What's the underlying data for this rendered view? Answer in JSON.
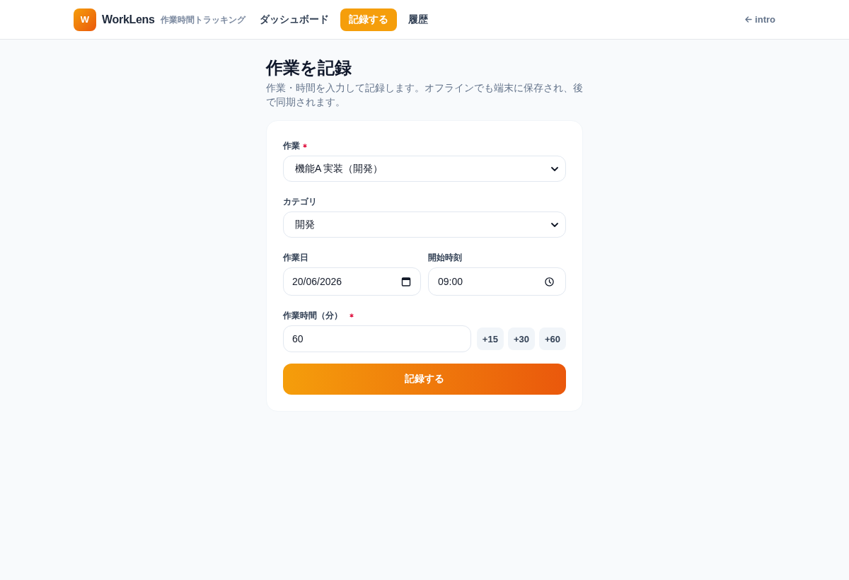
{
  "header": {
    "logo": {
      "letter": "W",
      "name": "WorkLens",
      "tagline": "作業時間トラッキング"
    },
    "nav": [
      {
        "label": "ダッシュボード",
        "selected": false
      },
      {
        "label": "記録する",
        "selected": true
      },
      {
        "label": "履歴",
        "selected": false
      }
    ],
    "back_link": {
      "label": "intro"
    }
  },
  "page": {
    "title": "作業を記録",
    "description": "作業・時間を入力して記録します。オフラインでも端末に保存され、後で同期されます。"
  },
  "form": {
    "rows": [
      {
        "fields": [
          {
            "kind": "select",
            "label": "作業",
            "required": true,
            "value": "機能A 実装（開発）"
          }
        ]
      },
      {
        "fields": [
          {
            "kind": "select",
            "label": "カテゴリ",
            "required": false,
            "value": "開発"
          }
        ]
      },
      {
        "fields": [
          {
            "kind": "date",
            "label": "作業日",
            "required": false,
            "value": "20/06/2026"
          },
          {
            "kind": "time",
            "label": "開始時刻",
            "required": false,
            "value": "09:00"
          }
        ]
      },
      {
        "fields": [
          {
            "kind": "number",
            "label": "作業時間（分）",
            "required": true,
            "value": "60",
            "presets": [
              "+15",
              "+30",
              "+60"
            ]
          }
        ]
      }
    ],
    "submit": "記録する"
  }
}
